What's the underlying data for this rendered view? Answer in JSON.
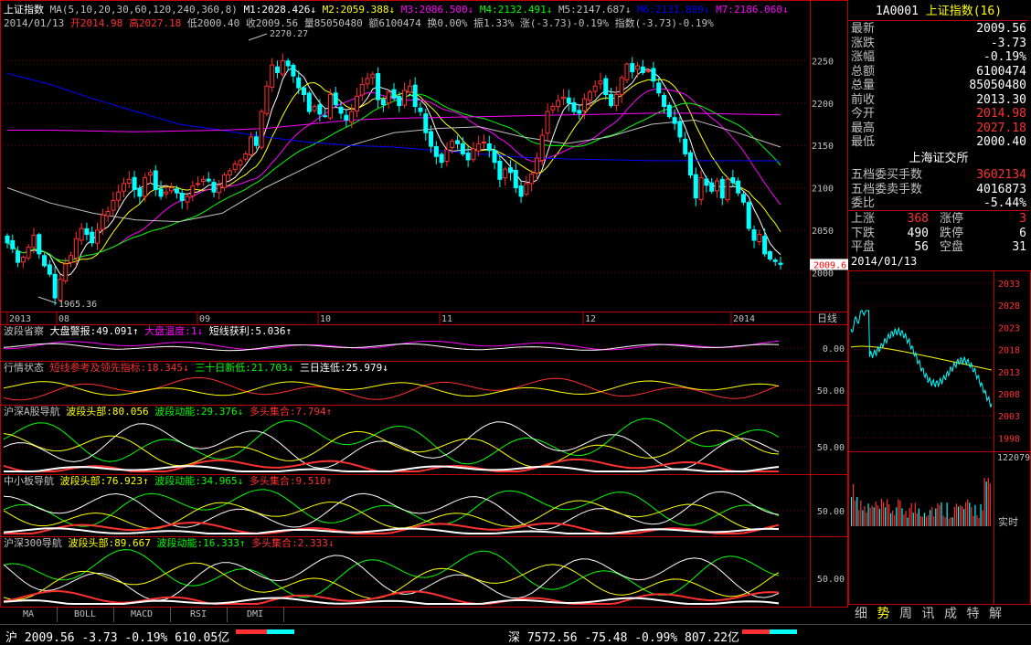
{
  "header": {
    "name": "上证指数",
    "ma_label": "MA(5,10,20,30,60,120,240,360,8)",
    "ma_items": [
      {
        "t": "M1:2028.426",
        "c": "#ffffff"
      },
      {
        "t": "M2:2059.388",
        "c": "#ffff00"
      },
      {
        "t": "M3:2086.500",
        "c": "#ff00ff"
      },
      {
        "t": "M4:2132.491",
        "c": "#00ff00"
      },
      {
        "t": "M5:2147.687",
        "c": "#c0c0c0"
      },
      {
        "t": "M6:2131.809",
        "c": "#0000ff"
      },
      {
        "t": "M7:2186.060",
        "c": "#ff00ff"
      }
    ],
    "date": "2014/01/13",
    "open": "开2014.98",
    "high": "高2027.18",
    "low": "低2000.40",
    "close": "收2009.56",
    "volume": "量85050480",
    "amount": "额6100474",
    "turnover": "换0.00%",
    "amplitude": "振1.33%",
    "change": "涨(-3.73)-0.19%",
    "index_change": "指数(-3.73)-0.19%"
  },
  "chart_data": [
    {
      "type": "candlestick",
      "title": "上证指数",
      "price_axis": [
        2000,
        2050,
        2100,
        2150,
        2200,
        2250
      ],
      "ylim": [
        1955,
        2285
      ],
      "x_labels": [
        "2013",
        "08",
        "09",
        "10",
        "11",
        "12",
        "2014"
      ],
      "period": "日线",
      "annotations": [
        "2270.27",
        "1965.36"
      ],
      "last_price": "2009.6",
      "closes": [
        2035,
        2028,
        2012,
        2018,
        2030,
        2044,
        2022,
        2008,
        1998,
        1970,
        1992,
        2010,
        2020,
        2040,
        2052,
        2045,
        2035,
        2050,
        2068,
        2072,
        2085,
        2095,
        2105,
        2110,
        2098,
        2090,
        2112,
        2118,
        2098,
        2090,
        2095,
        2100,
        2094,
        2085,
        2090,
        2102,
        2105,
        2110,
        2108,
        2095,
        2103,
        2115,
        2120,
        2128,
        2132,
        2140,
        2160,
        2150,
        2190,
        2220,
        2245,
        2236,
        2250,
        2244,
        2232,
        2218,
        2210,
        2190,
        2196,
        2187,
        2185,
        2210,
        2198,
        2188,
        2180,
        2190,
        2208,
        2222,
        2229,
        2234,
        2204,
        2198,
        2213,
        2206,
        2197,
        2215,
        2220,
        2196,
        2190,
        2165,
        2149,
        2137,
        2130,
        2145,
        2155,
        2152,
        2140,
        2133,
        2146,
        2152,
        2154,
        2144,
        2130,
        2110,
        2122,
        2118,
        2100,
        2090,
        2105,
        2116,
        2135,
        2162,
        2190,
        2196,
        2203,
        2207,
        2200,
        2190,
        2188,
        2205,
        2213,
        2220,
        2226,
        2210,
        2197,
        2210,
        2230,
        2246,
        2237,
        2244,
        2236,
        2238,
        2226,
        2212,
        2196,
        2184,
        2176,
        2160,
        2140,
        2115,
        2088,
        2112,
        2103,
        2096,
        2108,
        2088,
        2110,
        2106,
        2094,
        2083,
        2052,
        2038,
        2045,
        2022,
        2016,
        2013,
        2009.56
      ],
      "ma_series": [
        {
          "name": "M1",
          "value": "2028.426",
          "color": "#ffffff"
        },
        {
          "name": "M2",
          "value": "2059.388",
          "color": "#ffff00"
        },
        {
          "name": "M3",
          "value": "2086.500",
          "color": "#ff00ff"
        },
        {
          "name": "M4",
          "value": "2132.491",
          "color": "#00ff00"
        },
        {
          "name": "M5",
          "value": "2147.687",
          "color": "#c0c0c0"
        },
        {
          "name": "M6",
          "value": "2131.809",
          "color": "#0000ff"
        },
        {
          "name": "M7",
          "value": "2186.060",
          "color": "#ff00ff"
        }
      ]
    },
    {
      "type": "line",
      "title": "波段省察",
      "legend": [
        {
          "t": "大盘警报:49.091↑",
          "c": "#ffffff"
        },
        {
          "t": "大盘温度:1↓",
          "c": "#ff00ff"
        },
        {
          "t": "短线获利:5.036↑",
          "c": "#ffffff"
        }
      ],
      "axis_label": "0.00"
    },
    {
      "type": "line",
      "title": "行情状态",
      "legend": [
        {
          "t": "短线参考及领先指标:18.345↓",
          "c": "#ff3030"
        },
        {
          "t": "三十日新低:21.703↓",
          "c": "#00ff00"
        },
        {
          "t": "三日连低:25.979↓",
          "c": "#ffffff"
        }
      ],
      "axis_label": "50.00"
    },
    {
      "type": "line",
      "title": "沪深A股导航",
      "legend": [
        {
          "t": "波段头部:80.056",
          "c": "#ffff00"
        },
        {
          "t": "波段动能:29.376↓",
          "c": "#00ff00"
        },
        {
          "t": "多头集合:7.794↑",
          "c": "#ff3030"
        }
      ],
      "axis_label": "50.00"
    },
    {
      "type": "line",
      "title": "中小板导航",
      "legend": [
        {
          "t": "波段头部:76.923↑",
          "c": "#ffff00"
        },
        {
          "t": "波段动能:34.965↓",
          "c": "#00ff00"
        },
        {
          "t": "多头集合:9.510↑",
          "c": "#ff3030"
        }
      ],
      "axis_label": "50.00"
    },
    {
      "type": "line",
      "title": "沪深300导航",
      "legend": [
        {
          "t": "波段头部:89.667",
          "c": "#ffff00"
        },
        {
          "t": "波段动能:16.333↑",
          "c": "#00ff00"
        },
        {
          "t": "多头集合:2.333↓",
          "c": "#ff3030"
        }
      ],
      "axis_label": "50.00"
    },
    {
      "type": "line",
      "title": "2014/01/13",
      "price_axis": [
        "2033",
        "2028",
        "2023",
        "2018",
        "2013",
        "2008",
        "2003",
        "1998"
      ],
      "volume_axis": [
        "122079"
      ],
      "footer": "实时"
    }
  ],
  "quote": {
    "code": "1A0001",
    "name": "上证指数(16)",
    "rows": [
      {
        "label": "最新",
        "value": "2009.56",
        "c": "#ffffff"
      },
      {
        "label": "涨跌",
        "value": "-3.73",
        "c": "#ffffff"
      },
      {
        "label": "涨幅",
        "value": "-0.19%",
        "c": "#ffffff"
      },
      {
        "label": "总额",
        "value": "6100474",
        "c": "#ffffff"
      },
      {
        "label": "总量",
        "value": "85050480",
        "c": "#ffffff"
      },
      {
        "label": "前收",
        "value": "2013.30",
        "c": "#ffffff"
      },
      {
        "label": "今开",
        "value": "2014.98",
        "c": "#ff3030"
      },
      {
        "label": "最高",
        "value": "2027.18",
        "c": "#ff3030"
      },
      {
        "label": "最低",
        "value": "2000.40",
        "c": "#ffffff"
      }
    ],
    "exchange": "上海证交所",
    "rows2": [
      {
        "label": "五档委买手数",
        "value": "3602134",
        "c": "#ff3030"
      },
      {
        "label": "五档委卖手数",
        "value": "4016873",
        "c": "#ffffff"
      },
      {
        "label": "委比",
        "value": "-5.44%",
        "c": "#ffffff"
      }
    ],
    "breadth": [
      {
        "l1": "上涨",
        "v1": "368",
        "c1": "#ff3030",
        "l2": "涨停",
        "v2": "3",
        "c2": "#ff3030"
      },
      {
        "l1": "下跌",
        "v1": "490",
        "c1": "#ffffff",
        "l2": "跌停",
        "v2": "6",
        "c2": "#ffffff"
      },
      {
        "l1": "平盘",
        "v1": "56",
        "c1": "#ffffff",
        "l2": "空盘",
        "v2": "31",
        "c2": "#ffffff"
      }
    ]
  },
  "tabs": [
    "MA",
    "BOLL",
    "MACD",
    "RSI",
    "DMI"
  ],
  "side_tabs": [
    "细",
    "势",
    "周",
    "讯",
    "成",
    "特",
    "解"
  ],
  "status": {
    "sh": "沪 2009.56 -3.73 -0.19% 610.05亿",
    "sz": "深 7572.56 -75.48 -0.99% 807.22亿"
  },
  "colors": {
    "up": "#ff3030",
    "down": "#00ffff",
    "grid": "#800000",
    "border": "#c00000"
  }
}
